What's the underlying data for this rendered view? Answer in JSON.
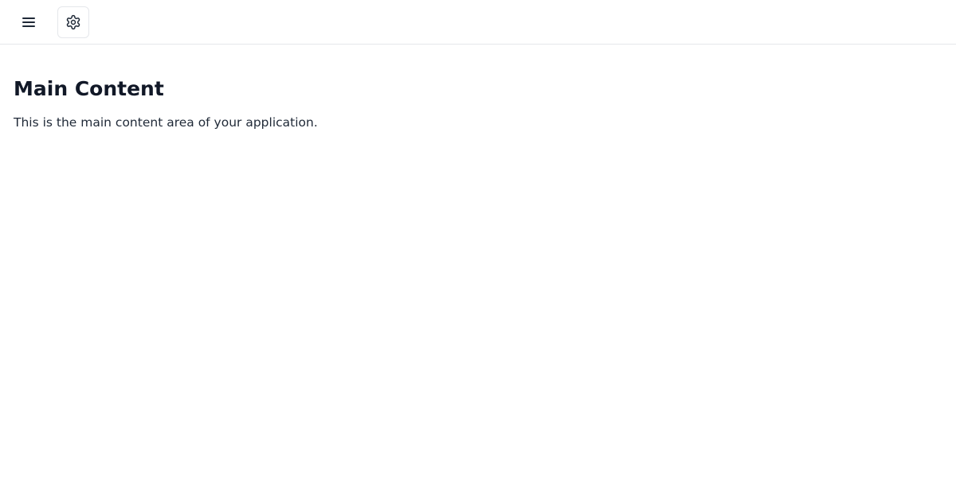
{
  "header": {
    "menu_icon": "hamburger-menu-icon",
    "settings_icon": "gear-icon"
  },
  "main": {
    "title": "Main Content",
    "description": "This is the main content area of your application."
  },
  "colors": {
    "text_primary": "#111827",
    "border": "#e5e7eb",
    "background": "#ffffff"
  }
}
